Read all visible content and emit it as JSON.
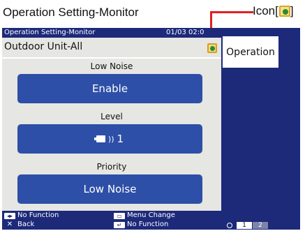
{
  "caption": "Operation Setting-Monitor",
  "icon_callout": {
    "label": "Icon[",
    "close": "]"
  },
  "titlebar": {
    "title": "Operation Setting-Monitor",
    "time": "01/03 02:0"
  },
  "unit_title": "Outdoor Unit-All",
  "sections": [
    {
      "label": "Low Noise",
      "value": "Enable"
    },
    {
      "label": "Level",
      "value": "1"
    },
    {
      "label": "Priority",
      "value": "Low Noise"
    }
  ],
  "side_tab": "Operation",
  "footer": {
    "left1": "No Function",
    "left2": "Back",
    "mid1": "Menu Change",
    "mid2": "No Function",
    "pages": [
      "1",
      "2"
    ]
  },
  "colors": {
    "screen_bg": "#1d2a7a",
    "button": "#2e4fa7",
    "panel": "#e6e6e3",
    "callout": "#e02020"
  }
}
